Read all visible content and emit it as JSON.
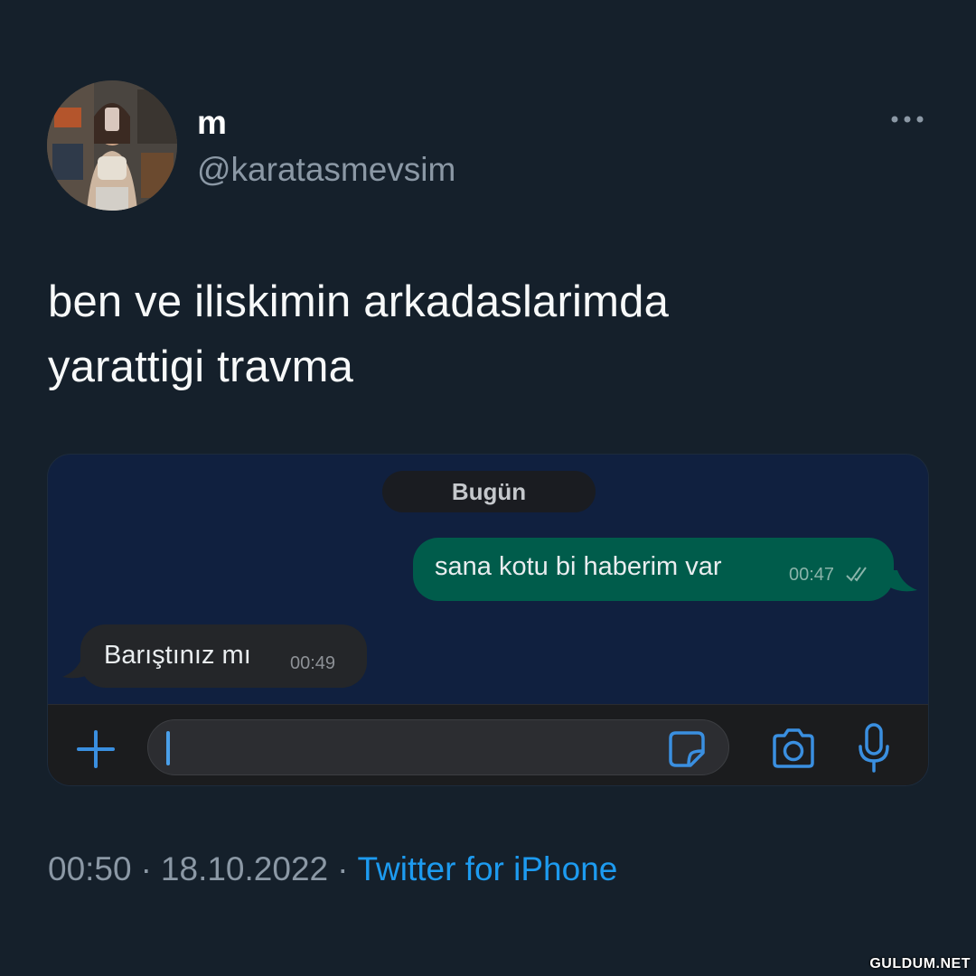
{
  "tweet": {
    "author": {
      "display_name": "m",
      "handle": "@karatasmevsim"
    },
    "more_icon": "more-horizontal-icon",
    "text_line1": "ben ve iliskimin arkadaslarimda",
    "text_line2": "yarattigi travma",
    "time": "00:50",
    "date": "18.10.2022",
    "separator": "·",
    "source": "Twitter for iPhone"
  },
  "chat": {
    "date_label": "Bugün",
    "messages": [
      {
        "direction": "outgoing",
        "text": "sana kotu bi haberim var",
        "time": "00:47",
        "status_icon": "double-check-icon"
      },
      {
        "direction": "incoming",
        "text": "Barıştınız mı",
        "time": "00:49"
      }
    ],
    "composer_icons": [
      "plus-icon",
      "sticker-icon",
      "camera-icon",
      "microphone-icon"
    ],
    "accent_color": "#3a8fe0",
    "outgoing_bubble_color": "#005c4b",
    "incoming_bubble_color": "#242629"
  },
  "colors": {
    "background": "#15202b",
    "secondary_text": "#8b98a5",
    "link": "#1d9bf0"
  },
  "watermark": "GULDUM.NET"
}
